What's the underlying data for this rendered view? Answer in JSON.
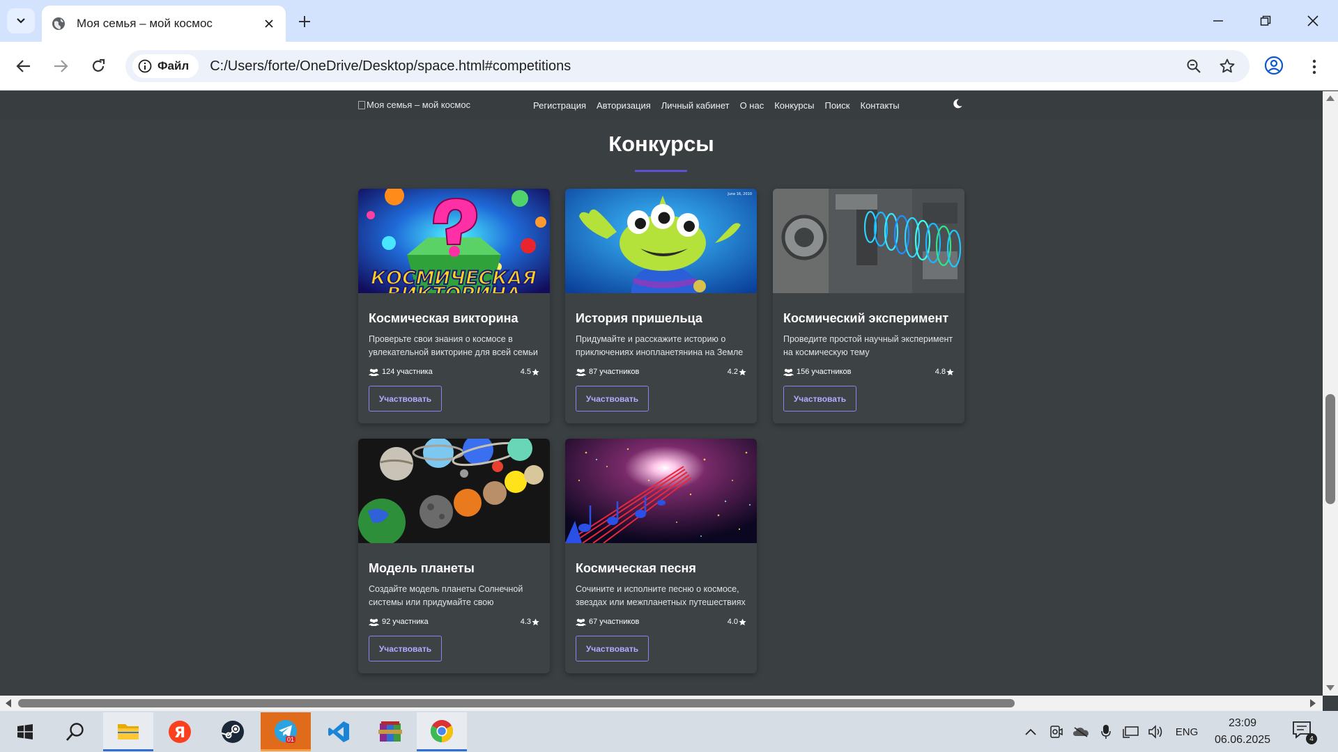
{
  "browser": {
    "tab_title": "Моя семья – мой космос",
    "site_chip_label": "Файл",
    "url": "C:/Users/forte/OneDrive/Desktop/space.html#competitions"
  },
  "site": {
    "logo_alt": "Моя семья – мой космос",
    "nav": [
      "Регистрация",
      "Авторизация",
      "Личный кабинет",
      "О нас",
      "Конкурсы",
      "Поиск",
      "Контакты"
    ],
    "section_title": "Конкурсы",
    "accent_color": "#5b50d6",
    "button_color": "#8c83ee",
    "cards": [
      {
        "title": "Космическая викторина",
        "description": "Проверьте свои знания о космосе в увлекательной викторине для всей семьи",
        "participants": "124 участника",
        "rating": "4.5",
        "button": "Участвовать",
        "image": "quiz-image"
      },
      {
        "title": "История пришельца",
        "description": "Придумайте и расскажите историю о приключениях инопланетянина на Земле",
        "participants": "87 участников",
        "rating": "4.2",
        "button": "Участвовать",
        "image": "alien-image",
        "image_caption": "June 16, 2010"
      },
      {
        "title": "Космический эксперимент",
        "description": "Проведите простой научный эксперимент на космическую тему",
        "participants": "156 участников",
        "rating": "4.8",
        "button": "Участвовать",
        "image": "experiment-image"
      },
      {
        "title": "Модель планеты",
        "description": "Создайте модель планеты Солнечной системы или придумайте свою",
        "participants": "92 участника",
        "rating": "4.3",
        "button": "Участвовать",
        "image": "planets-image"
      },
      {
        "title": "Космическая песня",
        "description": "Сочините и исполните песню о космосе, звездах или межпланетных путешествиях",
        "participants": "67 участников",
        "rating": "4.0",
        "button": "Участвовать",
        "image": "song-image"
      }
    ]
  },
  "taskbar": {
    "language": "ENG",
    "time": "23:09",
    "date": "06.06.2025",
    "telegram_badge": "01",
    "notifications": "4"
  }
}
